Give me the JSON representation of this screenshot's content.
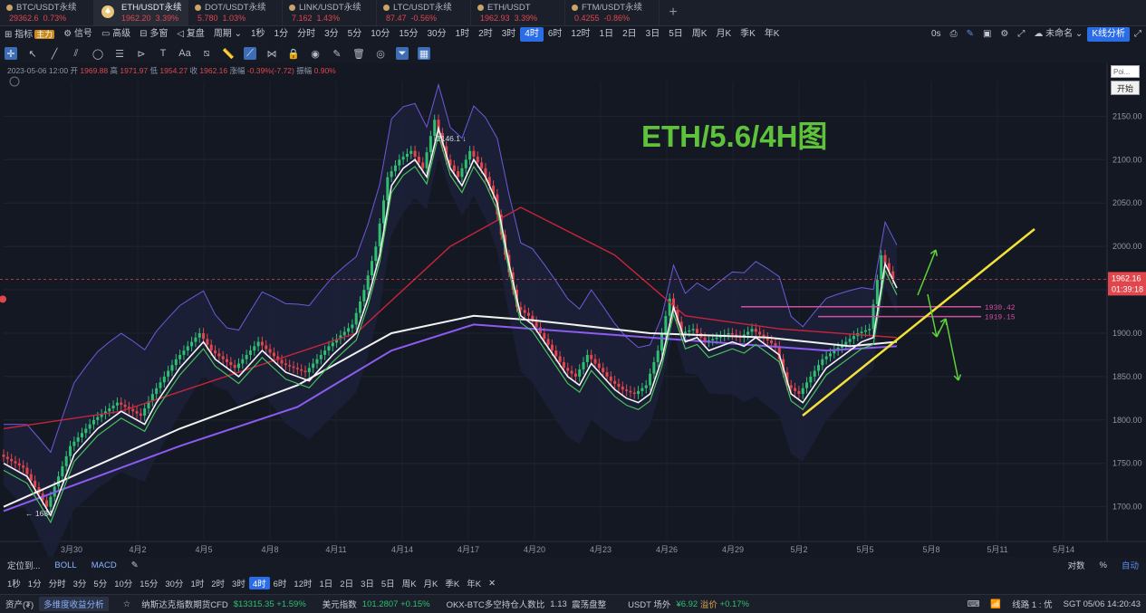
{
  "tabs": [
    {
      "name": "BTC/USDT永续",
      "price": "29362.6",
      "change": "0.73%",
      "active": false
    },
    {
      "name": "ETH/USDT永续",
      "price": "1962.20",
      "change": "3.39%",
      "active": true
    },
    {
      "name": "DOT/USDT永续",
      "price": "5.780",
      "change": "1.03%",
      "active": false
    },
    {
      "name": "LINK/USDT永续",
      "price": "7.162",
      "change": "1.43%",
      "active": false
    },
    {
      "name": "LTC/USDT永续",
      "price": "87.47",
      "change": "-0.56%",
      "active": false
    },
    {
      "name": "ETH/USDT",
      "price": "1962.93",
      "change": "3.39%",
      "active": false
    },
    {
      "name": "FTM/USDT永续",
      "price": "0.4255",
      "change": "-0.86%",
      "active": false
    }
  ],
  "toolbar": {
    "indicator": "指标",
    "main_badge": "主力",
    "signal": "信号",
    "advanced": "高级",
    "multi": "多窗",
    "replay": "复盘",
    "period": "周期",
    "intervals": [
      "1秒",
      "1分",
      "分时",
      "3分",
      "5分",
      "10分",
      "15分",
      "30分",
      "1时",
      "2时",
      "3时",
      "4时",
      "6时",
      "12时",
      "1日",
      "2日",
      "3日",
      "5日",
      "周K",
      "月K",
      "季K",
      "年K"
    ],
    "selected": "4时",
    "timer": "0s",
    "unnamed": "未命名",
    "kline_analysis": "K线分析"
  },
  "infoline": {
    "date": "2023-05-06 12:00",
    "open_label": "开",
    "open": "1969.88",
    "high_label": "高",
    "high": "1971.97",
    "low_label": "低",
    "low": "1954.27",
    "close_label": "收",
    "close": "1962.16",
    "chg_label": "涨幅",
    "chg": "-0.39%(-7.72)",
    "amp_label": "振幅",
    "amp": "0.90%"
  },
  "right_panel": {
    "input_placeholder": "Poi...",
    "start": "开始"
  },
  "indicators": {
    "locate": "定位到...",
    "boll": "BOLL",
    "macd": "MACD",
    "log": "对数",
    "pct": "%",
    "auto": "自动"
  },
  "sub_intervals": [
    "1秒",
    "1分",
    "分时",
    "3分",
    "5分",
    "10分",
    "15分",
    "30分",
    "1时",
    "2时",
    "3时",
    "4时",
    "6时",
    "12时",
    "1日",
    "2日",
    "3日",
    "5日",
    "周K",
    "月K",
    "季K",
    "年K"
  ],
  "sub_selected": "4时",
  "status": {
    "assets": "资产(₮)",
    "multi_analysis": "多维度收益分析",
    "nasdaq_label": "纳斯达克指数期货CFD",
    "nasdaq": "$13315.35",
    "nasdaq_chg": "+1.59%",
    "dxy_label": "美元指数",
    "dxy": "101.2807",
    "dxy_chg": "+0.15%",
    "okx_label": "OKX-BTC多空持仓人数比",
    "okx": "1.13",
    "okx_state": "震荡盘整",
    "usdt_label": "USDT 场外",
    "usdt": "¥6.92",
    "premium_label": "溢价",
    "premium": "+0.17%",
    "line_label": "线路 1 : 优",
    "clock": "SGT 05/06 14:20:43"
  },
  "chart_data": {
    "type": "candlestick",
    "title": "ETH/5.6/4H图",
    "x_ticks": [
      "3月30",
      "4月2",
      "4月5",
      "4月8",
      "4月11",
      "4月14",
      "4月17",
      "4月20",
      "4月23",
      "4月26",
      "4月29",
      "5月2",
      "5月5",
      "5月8",
      "5月11",
      "5月14"
    ],
    "y_ticks": [
      1700,
      1750,
      1800,
      1850,
      1900,
      1950,
      2000,
      2050,
      2100,
      2150
    ],
    "ylim": [
      1660,
      2190
    ],
    "last_price": "1962.16",
    "countdown": "01:39:18",
    "annotations": {
      "high": "2146.1",
      "low": "1684",
      "level1": "1930.42",
      "level2": "1919.15"
    },
    "price_path": [
      [
        0,
        1760
      ],
      [
        2,
        1745
      ],
      [
        4,
        1700
      ],
      [
        6,
        1770
      ],
      [
        8,
        1800
      ],
      [
        10,
        1820
      ],
      [
        12,
        1805
      ],
      [
        13,
        1830
      ],
      [
        15,
        1870
      ],
      [
        17,
        1900
      ],
      [
        18,
        1880
      ],
      [
        20,
        1860
      ],
      [
        22,
        1890
      ],
      [
        24,
        1865
      ],
      [
        26,
        1855
      ],
      [
        28,
        1885
      ],
      [
        30,
        1910
      ],
      [
        31,
        1950
      ],
      [
        32,
        2000
      ],
      [
        33,
        2080
      ],
      [
        34,
        2100
      ],
      [
        35,
        2110
      ],
      [
        36,
        2090
      ],
      [
        37,
        2146
      ],
      [
        38,
        2100
      ],
      [
        39,
        2080
      ],
      [
        40,
        2110
      ],
      [
        41,
        2090
      ],
      [
        42,
        2060
      ],
      [
        43,
        1990
      ],
      [
        44,
        1930
      ],
      [
        45,
        1920
      ],
      [
        46,
        1900
      ],
      [
        47,
        1880
      ],
      [
        48,
        1860
      ],
      [
        49,
        1850
      ],
      [
        50,
        1875
      ],
      [
        51,
        1860
      ],
      [
        52,
        1845
      ],
      [
        53,
        1835
      ],
      [
        54,
        1830
      ],
      [
        55,
        1840
      ],
      [
        56,
        1880
      ],
      [
        57,
        1940
      ],
      [
        58,
        1900
      ],
      [
        59,
        1905
      ],
      [
        60,
        1890
      ],
      [
        61,
        1895
      ],
      [
        62,
        1900
      ],
      [
        63,
        1895
      ],
      [
        64,
        1905
      ],
      [
        65,
        1895
      ],
      [
        66,
        1885
      ],
      [
        67,
        1840
      ],
      [
        68,
        1830
      ],
      [
        69,
        1850
      ],
      [
        70,
        1870
      ],
      [
        71,
        1880
      ],
      [
        72,
        1890
      ],
      [
        73,
        1900
      ],
      [
        74,
        1905
      ],
      [
        75,
        1990
      ],
      [
        76,
        1962
      ]
    ],
    "ma_white": [
      [
        0,
        1700
      ],
      [
        15,
        1790
      ],
      [
        25,
        1840
      ],
      [
        33,
        1900
      ],
      [
        40,
        1920
      ],
      [
        45,
        1915
      ],
      [
        55,
        1900
      ],
      [
        65,
        1895
      ],
      [
        72,
        1885
      ],
      [
        76,
        1890
      ]
    ],
    "ma_purple": [
      [
        0,
        1695
      ],
      [
        15,
        1770
      ],
      [
        25,
        1815
      ],
      [
        33,
        1880
      ],
      [
        40,
        1910
      ],
      [
        50,
        1900
      ],
      [
        60,
        1890
      ],
      [
        70,
        1880
      ],
      [
        76,
        1885
      ]
    ],
    "ma_red": [
      [
        0,
        1790
      ],
      [
        10,
        1810
      ],
      [
        20,
        1855
      ],
      [
        30,
        1900
      ],
      [
        38,
        2000
      ],
      [
        44,
        2045
      ],
      [
        52,
        1990
      ],
      [
        58,
        1920
      ],
      [
        66,
        1905
      ],
      [
        76,
        1895
      ]
    ]
  }
}
